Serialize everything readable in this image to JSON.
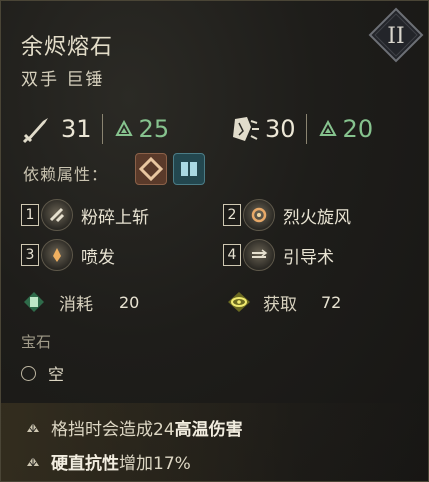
{
  "item": {
    "name": "余烬熔石",
    "type": "双手 巨锤",
    "tier": "II"
  },
  "stats": {
    "attack": "31",
    "attack_bonus": "25",
    "stagger": "30",
    "stagger_bonus": "20"
  },
  "requirements": {
    "label": "依赖属性："
  },
  "skills": [
    {
      "num": "1",
      "name": "粉碎上斩"
    },
    {
      "num": "2",
      "name": "烈火旋风"
    },
    {
      "num": "3",
      "name": "喷发"
    },
    {
      "num": "4",
      "name": "引导术"
    }
  ],
  "resources": {
    "cost_label": "消耗",
    "cost_value": "20",
    "gain_label": "获取",
    "gain_value": "72"
  },
  "gem": {
    "header": "宝石",
    "slot": "空"
  },
  "perks": [
    {
      "pre": "格挡时会造成24",
      "bold": "高温伤害",
      "post": ""
    },
    {
      "pre": "",
      "bold": "硬直抗性",
      "post": "增加17%"
    }
  ],
  "colors": {
    "bonus_green": "#86c38e",
    "text_light": "#e3ddc9"
  }
}
